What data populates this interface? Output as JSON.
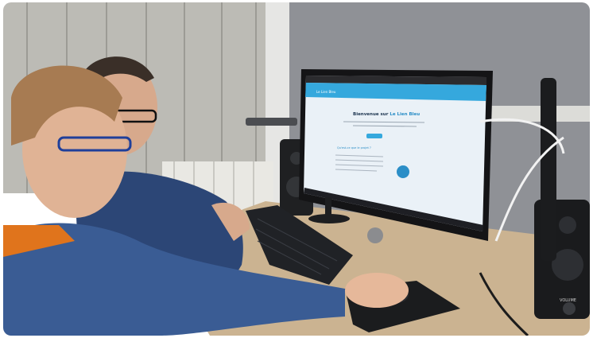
{
  "photo": {
    "description_colors": {
      "wall_wood": "#b9b8b2",
      "wall_grey": "#8e9095",
      "desk": "#c9b18f",
      "hoodie": "#2f4a7a",
      "orange_collar": "#e0741c",
      "monitor_screen": "#eaf1f7",
      "site_header": "#35a8dd"
    }
  },
  "screen": {
    "brand": "Le Lien Bleu",
    "welcome_prefix": "Bienvenue sur ",
    "welcome_brand": "Le Lien Bleu",
    "section_title": "Qu'est-ce que le projet ?"
  },
  "speaker": {
    "knob_label": "VOLUME"
  }
}
